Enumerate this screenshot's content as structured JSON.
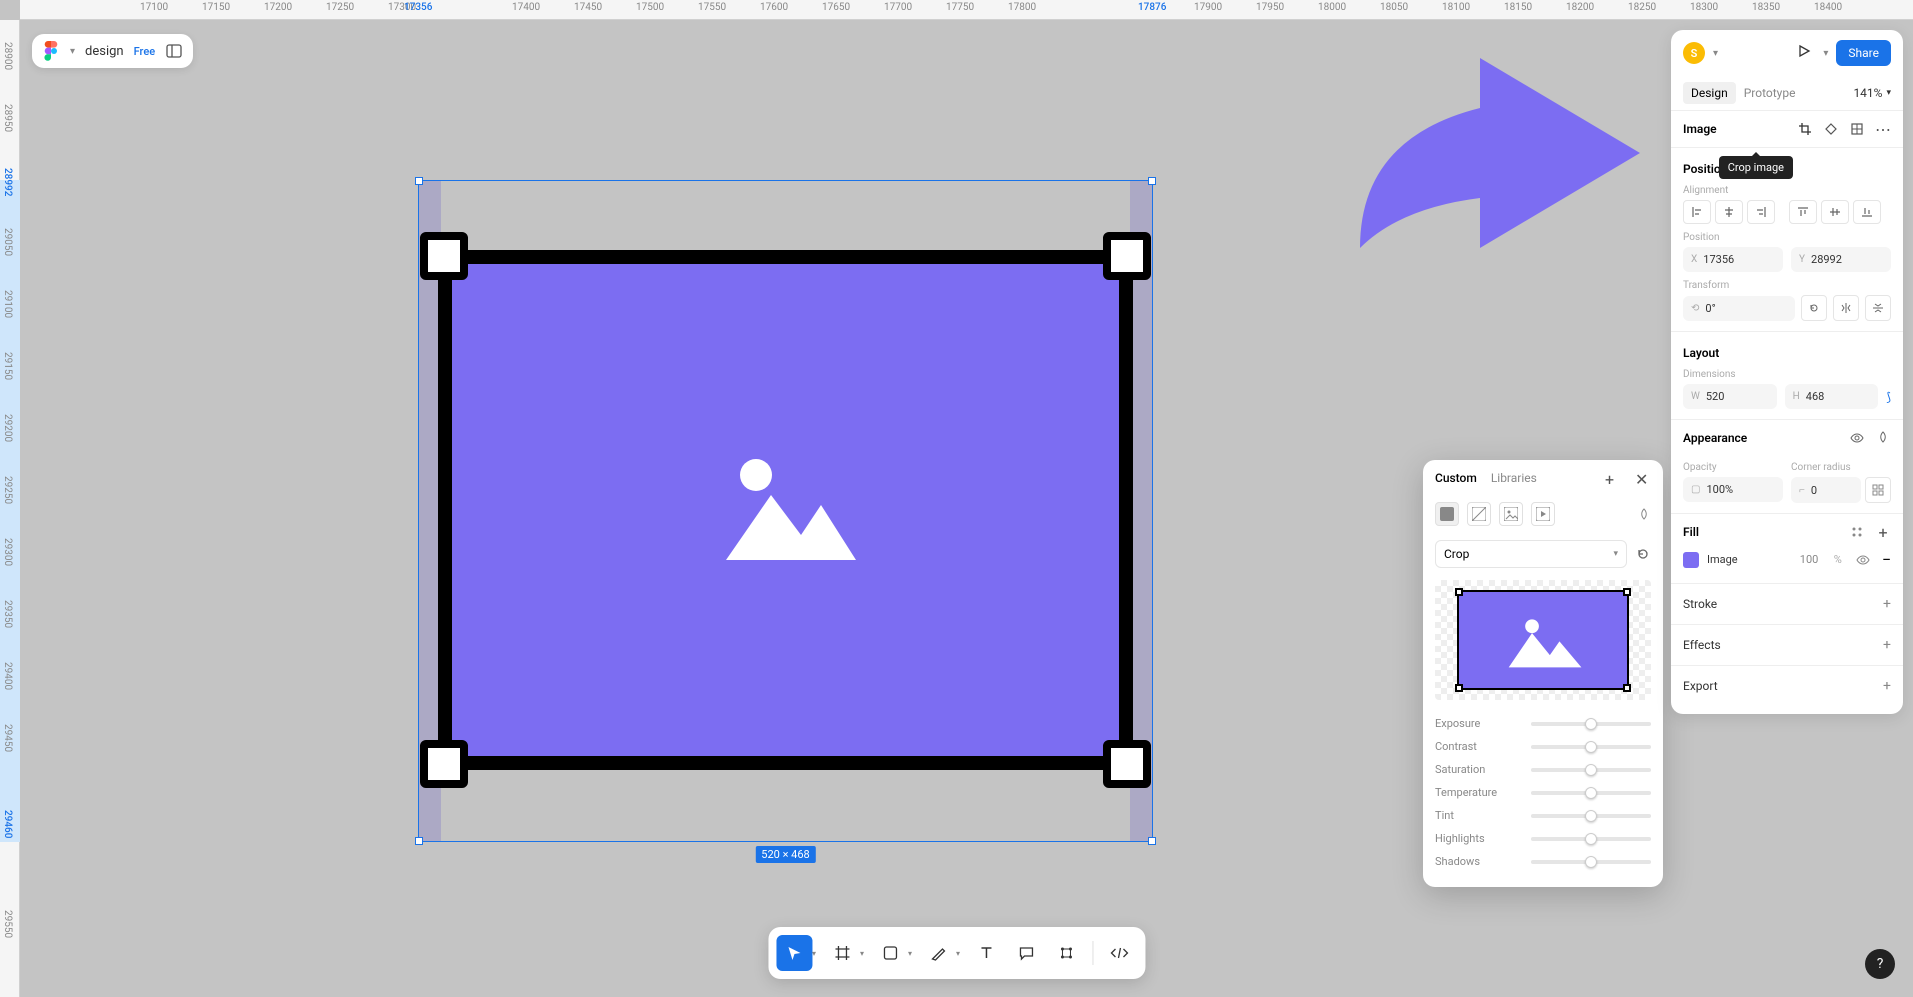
{
  "header": {
    "file_name": "design",
    "badge": "Free",
    "avatar_letter": "S",
    "share_label": "Share",
    "zoom": "141%"
  },
  "rulers": {
    "top": [
      "17100",
      "17150",
      "17200",
      "17250",
      "17300",
      "17356",
      "17400",
      "17450",
      "17500",
      "17550",
      "17600",
      "17650",
      "17700",
      "17750",
      "17800",
      "17876",
      "17900",
      "17950",
      "18000",
      "18050",
      "18100",
      "18150",
      "18200",
      "18250",
      "18300",
      "18350",
      "18400"
    ],
    "top_blue_indices": [
      5,
      15
    ],
    "left": [
      "28900",
      "28950",
      "28992",
      "29050",
      "29100",
      "29150",
      "29200",
      "29250",
      "29300",
      "29350",
      "29400",
      "29450",
      "29460",
      "29550"
    ],
    "left_blue_indices": [
      2,
      12
    ]
  },
  "selection": {
    "dimension_label": "520 × 468"
  },
  "tabs": {
    "design": "Design",
    "prototype": "Prototype"
  },
  "inspector": {
    "image_title": "Image",
    "tooltip": "Crop image",
    "position_title": "Position",
    "alignment_label": "Alignment",
    "position_label": "Position",
    "x": "17356",
    "y": "28992",
    "transform_label": "Transform",
    "rotation": "0°",
    "layout_title": "Layout",
    "dimensions_label": "Dimensions",
    "w": "520",
    "h": "468",
    "appearance_title": "Appearance",
    "opacity_label": "Opacity",
    "opacity": "100%",
    "corner_label": "Corner radius",
    "corner": "0",
    "fill_title": "Fill",
    "fill_name": "Image",
    "fill_opacity": "100",
    "fill_pct": "%",
    "stroke_title": "Stroke",
    "effects_title": "Effects",
    "export_title": "Export"
  },
  "image_panel": {
    "tab_custom": "Custom",
    "tab_libraries": "Libraries",
    "mode": "Crop",
    "sliders": [
      "Exposure",
      "Contrast",
      "Saturation",
      "Temperature",
      "Tint",
      "Highlights",
      "Shadows"
    ]
  }
}
